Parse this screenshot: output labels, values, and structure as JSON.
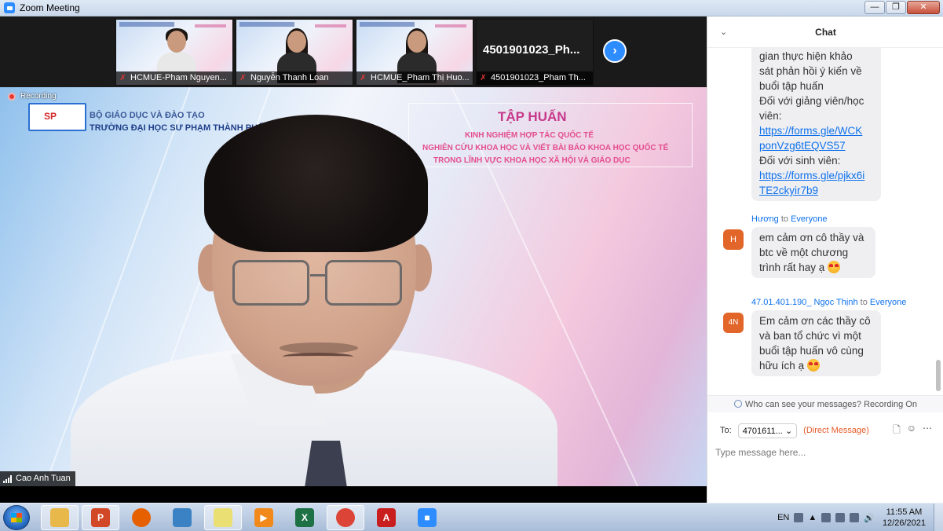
{
  "window": {
    "title": "Zoom Meeting"
  },
  "thumbnails": [
    {
      "name": "HCMUE-Pham Nguyen...",
      "muted": true,
      "video": true,
      "hair": "short",
      "top": "light"
    },
    {
      "name": "Nguyễn Thanh Loan",
      "muted": true,
      "video": true,
      "hair": "long",
      "top": "dark"
    },
    {
      "name": "HCMUE_Pham Thị Huo...",
      "muted": true,
      "video": true,
      "hair": "long",
      "top": "dark"
    },
    {
      "name": "4501901023_Pham Th...",
      "muted": true,
      "video": false,
      "display": "4501901023_Ph..."
    }
  ],
  "slide": {
    "ministry": "BỘ GIÁO DỤC VÀ ĐÀO TẠO",
    "university": "TRƯỜNG ĐẠI HỌC SƯ PHẠM THÀNH PHỐ HỒ CHÍ MINH",
    "logo": "SP",
    "training_title": "TẬP HUẤN",
    "training_lines": [
      "KINH NGHIỆM HỢP TÁC QUỐC TẾ",
      "NGHIÊN CỨU KHOA HỌC VÀ VIẾT BÀI BÁO KHOA HỌC QUỐC TẾ",
      "TRONG LĨNH VỰC KHOA HỌC XÃ HỘI VÀ GIÁO DỤC"
    ]
  },
  "main_video": {
    "recording_label": "Recording",
    "speaker_name": "Cao Anh Tuan"
  },
  "chat": {
    "title": "Chat",
    "first_message_lines": [
      "gian thực hiện khảo",
      "sát phản hồi ý kiến về",
      "buổi tập huấn",
      "Đối với giảng viên/học",
      "viên:"
    ],
    "link1": [
      "https://forms.gle/WCK",
      "ponVzg6tEQVS57"
    ],
    "student_label": "Đối với sinh viên:",
    "link2": [
      "https://forms.gle/pjkx6i",
      "TE2ckyir7b9"
    ],
    "messages": [
      {
        "sender": "Hương",
        "to_word": "to",
        "recipient": "Everyone",
        "avatar": "H",
        "lines": [
          "em cảm ơn cô thầy và",
          "btc về một chương",
          "trình rất hay ạ"
        ]
      },
      {
        "sender": "47.01.401.190_ Ngọc Thịnh",
        "to_word": "to",
        "recipient": "Everyone",
        "avatar": "4N",
        "lines": [
          "Em cảm ơn các thầy cô",
          "và ban tổ chức vì một",
          "buổi tập huấn vô cùng",
          "hữu ích ạ"
        ]
      }
    ],
    "notice": "Who can see your messages? Recording On",
    "to_label": "To:",
    "recipient_select": "4701611...",
    "direct_message": "(Direct Message)",
    "input_placeholder": "Type message here..."
  },
  "taskbar": {
    "items": [
      {
        "name": "file-explorer",
        "glyph": "",
        "color": "#e8b84a",
        "active": true
      },
      {
        "name": "powerpoint",
        "glyph": "P",
        "color": "#d24726",
        "active": true
      },
      {
        "name": "firefox",
        "glyph": "",
        "color": "#e66000",
        "active": false
      },
      {
        "name": "outlook",
        "glyph": "",
        "color": "#3b82c4",
        "active": false
      },
      {
        "name": "sticky-notes",
        "glyph": "",
        "color": "#e9df73",
        "active": true
      },
      {
        "name": "media-player",
        "glyph": "▶",
        "color": "#f18a1b",
        "active": false
      },
      {
        "name": "excel",
        "glyph": "X",
        "color": "#1e7145",
        "active": false
      },
      {
        "name": "chrome",
        "glyph": "",
        "color": "#db4437",
        "active": true
      },
      {
        "name": "acrobat",
        "glyph": "A",
        "color": "#c81e1e",
        "active": false
      },
      {
        "name": "zoom",
        "glyph": "■",
        "color": "#2d8cff",
        "active": false
      }
    ],
    "language": "EN",
    "time": "11:55 AM",
    "date": "12/26/2021"
  },
  "colors": {
    "accent": "#2d8cff",
    "link": "#0e71eb",
    "avatar": "#e2662a",
    "recording": "#e53935"
  }
}
